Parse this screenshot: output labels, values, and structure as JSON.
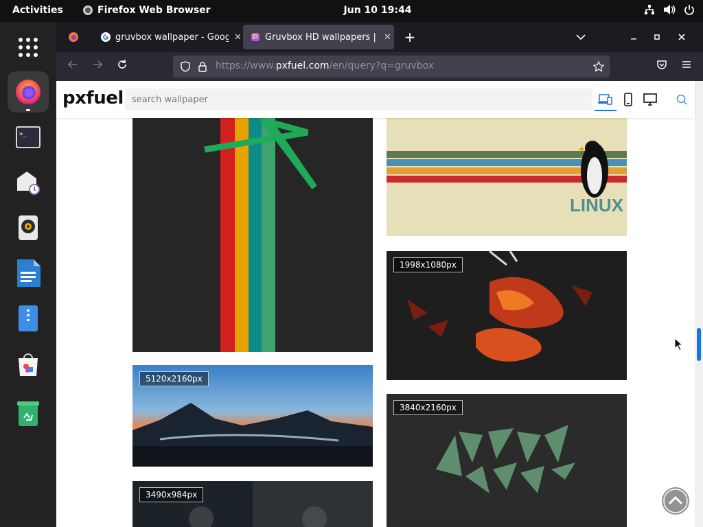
{
  "topbar": {
    "activities": "Activities",
    "app_name": "Firefox Web Browser",
    "clock": "Jun 10  19:44",
    "tray_icons": [
      "network-icon",
      "volume-icon",
      "power-icon"
    ]
  },
  "dock": {
    "items": [
      "app-grid",
      "firefox",
      "terminal",
      "mail-clock",
      "rhythmbox",
      "libreoffice-writer",
      "file-archive",
      "software-center",
      "trash"
    ]
  },
  "browser": {
    "tabs": [
      {
        "title": "gruvbox wallpaper - Google"
      },
      {
        "title": "Gruvbox HD wallpapers | Px"
      }
    ],
    "new_tab": "+",
    "url_prefix": "https://www.",
    "url_domain": "pxfuel.com",
    "url_path": "/en/query?q=gruvbox"
  },
  "site": {
    "logo": "pxfuel",
    "search_placeholder": "search wallpaper"
  },
  "wallpapers": [
    {
      "resolution": "",
      "theme": "gruvbox stripes star",
      "colors": [
        "#d41f1f",
        "#e8a200",
        "#0e8a87",
        "#3da36f"
      ]
    },
    {
      "resolution": "",
      "theme": "linux penguin stripes"
    },
    {
      "resolution": "1998x1080px",
      "theme": "abstract red orange"
    },
    {
      "resolution": "5120x2160px",
      "theme": "volcano sunset"
    },
    {
      "resolution": "3840x2160px",
      "theme": "green triangles"
    },
    {
      "resolution": "3490x984px",
      "theme": "astronaut"
    }
  ],
  "linux_label": "LINUX"
}
